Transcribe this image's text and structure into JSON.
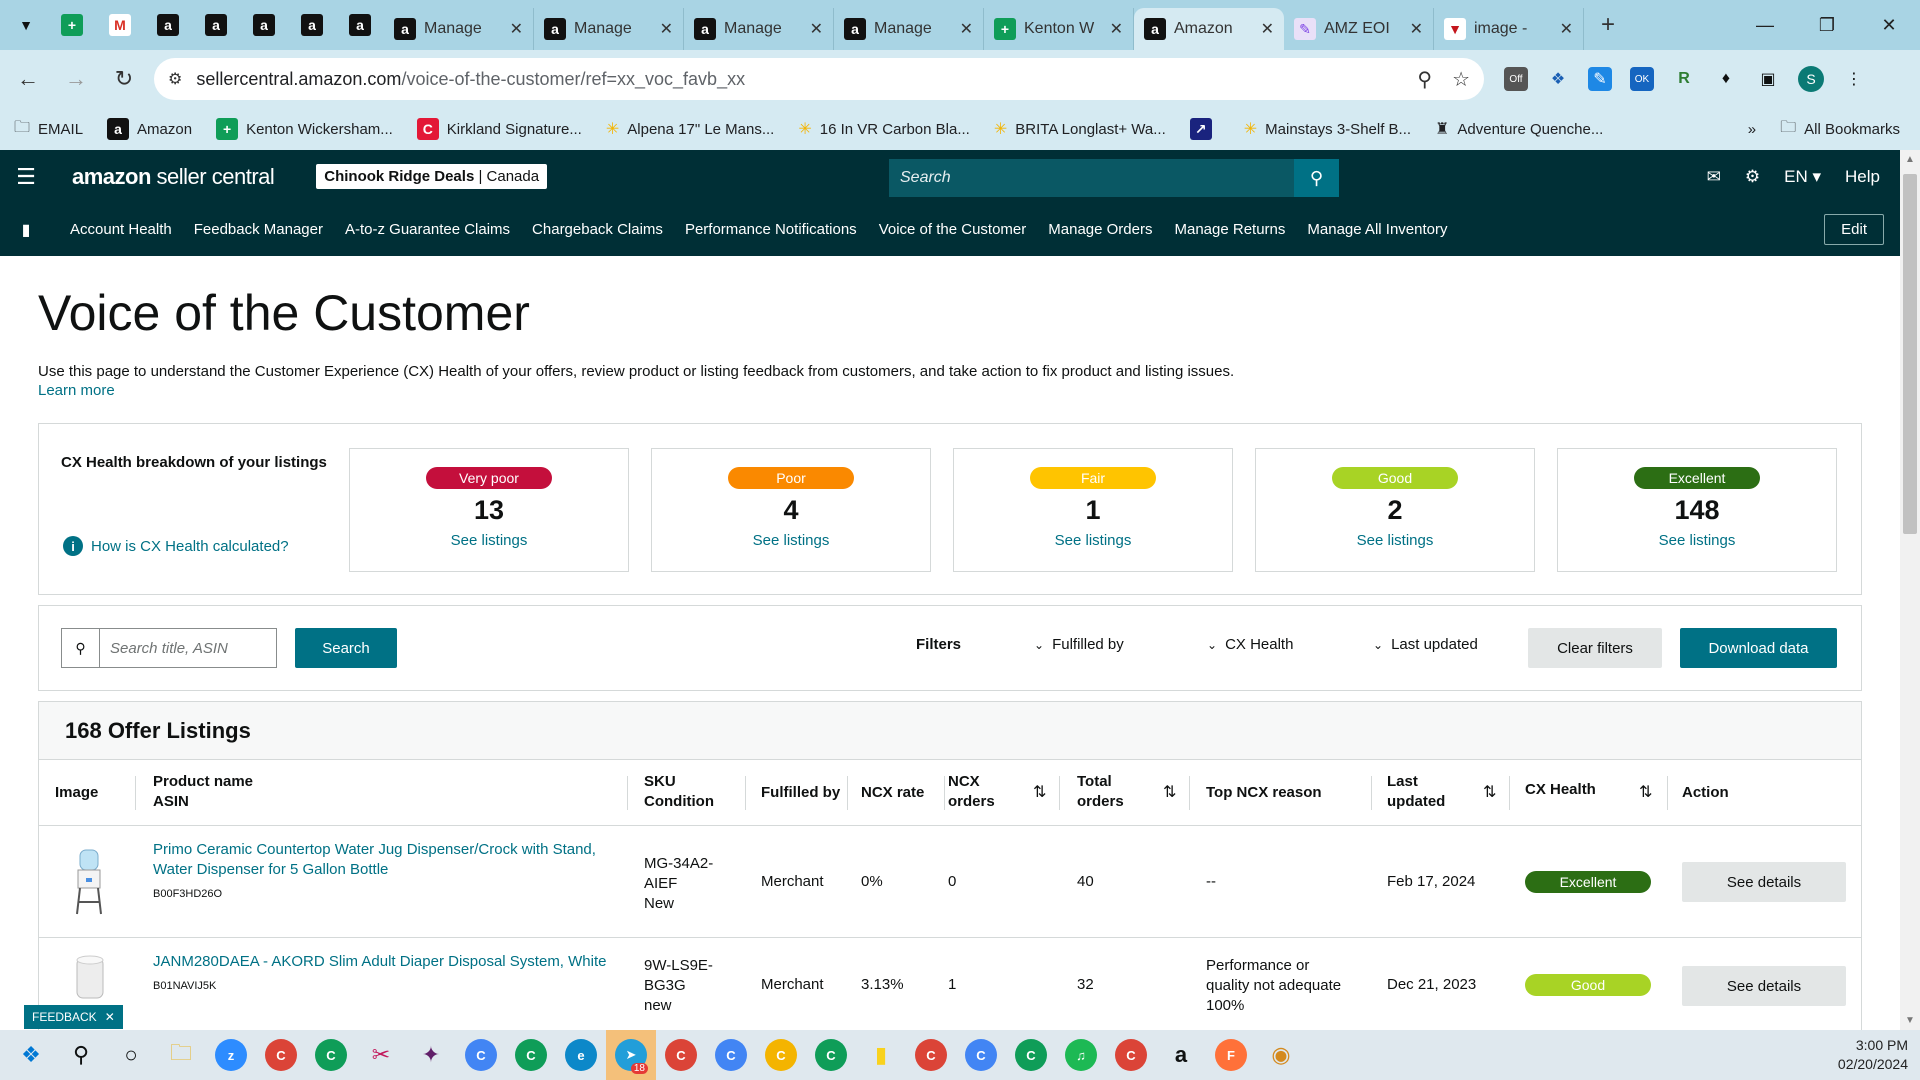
{
  "browser": {
    "tabs": [
      {
        "title": "Manage",
        "icon": "amazon"
      },
      {
        "title": "Manage",
        "icon": "amazon"
      },
      {
        "title": "Manage",
        "icon": "amazon"
      },
      {
        "title": "Manage",
        "icon": "amazon"
      },
      {
        "title": "Kenton W",
        "icon": "sheets"
      },
      {
        "title": "Amazon",
        "icon": "amazon",
        "active": true
      },
      {
        "title": "AMZ EOI",
        "icon": "pencil"
      },
      {
        "title": "image -",
        "icon": "image"
      }
    ],
    "url_host": "sellercentral.amazon.com",
    "url_path": "/voice-of-the-customer/ref=xx_voc_favb_xx",
    "bookmarks": [
      {
        "label": "EMAIL",
        "icon": "folder"
      },
      {
        "label": "Amazon",
        "icon": "amazon"
      },
      {
        "label": "Kenton Wickersham...",
        "icon": "sheets"
      },
      {
        "label": "Kirkland Signature...",
        "icon": "costco"
      },
      {
        "label": "Alpena 17\" Le Mans...",
        "icon": "walmart"
      },
      {
        "label": "16 In VR Carbon Bla...",
        "icon": "walmart"
      },
      {
        "label": "BRITA Longlast+ Wa...",
        "icon": "walmart"
      },
      {
        "label": "",
        "icon": "chart"
      },
      {
        "label": "Mainstays 3-Shelf B...",
        "icon": "walmart"
      },
      {
        "label": "Adventure Quenche...",
        "icon": "cow"
      }
    ],
    "all_bookmarks": "All Bookmarks",
    "profile_initial": "S"
  },
  "header": {
    "logo_main": "amazon",
    "logo_sub": "seller central",
    "store_name": "Chinook Ridge Deals",
    "store_region": "Canada",
    "search_placeholder": "Search",
    "lang": "EN",
    "help": "Help"
  },
  "nav": {
    "links": [
      "Account Health",
      "Feedback Manager",
      "A-to-z Guarantee Claims",
      "Chargeback Claims",
      "Performance Notifications",
      "Voice of the Customer",
      "Manage Orders",
      "Manage Returns",
      "Manage All Inventory"
    ],
    "edit": "Edit"
  },
  "page": {
    "title": "Voice of the Customer",
    "intro": "Use this page to understand the Customer Experience (CX) Health of your offers, review product or listing feedback from customers, and take action to fix product and listing issues.",
    "learn_more": "Learn more"
  },
  "cx_health": {
    "label": "CX Health breakdown of your listings",
    "how": "How is CX Health calculated?",
    "see": "See listings",
    "cards": [
      {
        "rating": "Very poor",
        "count": "13",
        "color": "#c40f3c",
        "text_color": "#ffffff"
      },
      {
        "rating": "Poor",
        "count": "4",
        "color": "#fa8900",
        "text_color": "#ffffff"
      },
      {
        "rating": "Fair",
        "count": "1",
        "color": "#ffc400",
        "text_color": "#ffffff"
      },
      {
        "rating": "Good",
        "count": "2",
        "color": "#a8d325",
        "text_color": "#ffffff"
      },
      {
        "rating": "Excellent",
        "count": "148",
        "color": "#2c6e14",
        "text_color": "#ffffff"
      }
    ]
  },
  "filters": {
    "search_placeholder": "Search title, ASIN",
    "search_button": "Search",
    "filters_label": "Filters",
    "fulfilled_by": "Fulfilled by",
    "cx_health": "CX Health",
    "last_updated": "Last updated",
    "clear": "Clear filters",
    "download": "Download data"
  },
  "listings": {
    "heading": "168 Offer Listings",
    "columns": {
      "image": "Image",
      "product_name": "Product name",
      "asin": "ASIN",
      "sku": "SKU",
      "condition": "Condition",
      "fulfilled_by": "Fulfilled by",
      "ncx_rate": "NCX rate",
      "ncx_orders_1": "NCX",
      "ncx_orders_2": "orders",
      "total_orders_1": "Total",
      "total_orders_2": "orders",
      "top_reason": "Top NCX reason",
      "last_updated_1": "Last",
      "last_updated_2": "updated",
      "cx_health": "CX Health",
      "action": "Action"
    },
    "rows": [
      {
        "name_line1": "Primo Ceramic Countertop Water Jug Dispenser/Crock with Stand,",
        "name_line2": "Water Dispenser for 5 Gallon Bottle",
        "asin": "B00F3HD26O",
        "sku_line1": "MG-34A2-",
        "sku_line2": "AIEF",
        "condition": "New",
        "fulfilled_by": "Merchant",
        "ncx_rate": "0%",
        "ncx_orders": "0",
        "total_orders": "40",
        "reason_line1": "--",
        "reason_line2": "",
        "reason_line3": "",
        "last_updated": "Feb 17, 2024",
        "cx_health": "Excellent",
        "cx_color": "#2c6e14",
        "action": "See details"
      },
      {
        "name_line1": "JANM280DAEA - AKORD Slim Adult Diaper Disposal System, White",
        "name_line2": "",
        "asin": "B01NAVIJ5K",
        "sku_line1": "9W-LS9E-",
        "sku_line2": "BG3G",
        "condition": "new",
        "fulfilled_by": "Merchant",
        "ncx_rate": "3.13%",
        "ncx_orders": "1",
        "total_orders": "32",
        "reason_line1": "Performance or",
        "reason_line2": "quality not adequate",
        "reason_line3": "100%",
        "last_updated": "Dec 21, 2023",
        "cx_health": "Good",
        "cx_color": "#a8d325",
        "action": "See details"
      }
    ]
  },
  "feedback_tab": "FEEDBACK",
  "taskbar": {
    "time": "3:00 PM",
    "date": "02/20/2024",
    "badge": "18"
  }
}
